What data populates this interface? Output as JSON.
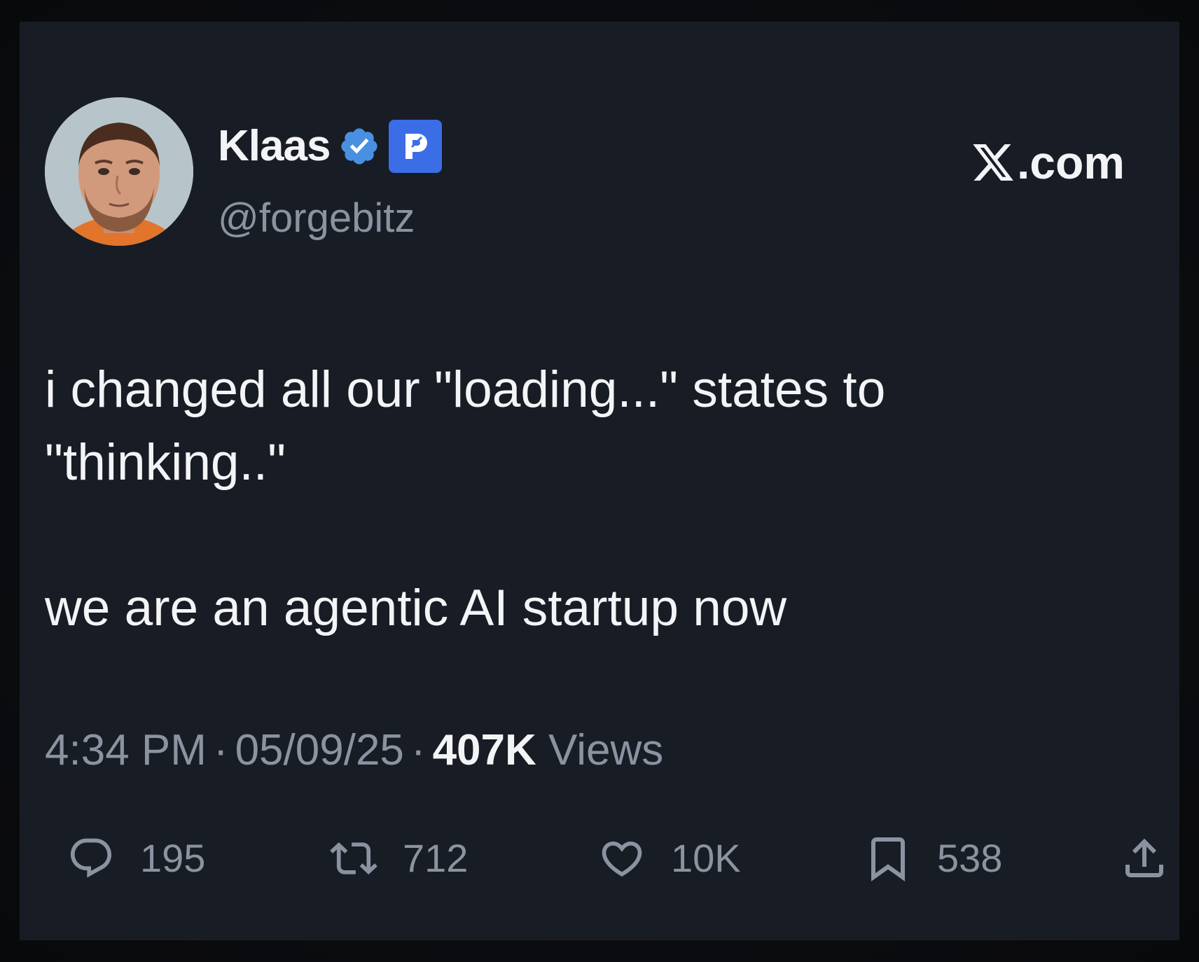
{
  "author": {
    "name": "Klaas",
    "handle": "@forgebitz",
    "verified_icon": "verified-badge-icon",
    "affiliate_icon": "brand-badge-icon"
  },
  "site": {
    "logo_icon": "x-logo-icon",
    "label": ".com"
  },
  "tweet": {
    "lines": [
      "i changed all our \"loading...\" states to",
      "\"thinking..\"",
      "",
      "we are an agentic AI startup now"
    ]
  },
  "meta": {
    "time": "4:34 PM",
    "separator": "·",
    "date": "05/09/25",
    "views_count": "407K",
    "views_label": "Views"
  },
  "actions": {
    "reply": {
      "icon": "reply-icon",
      "count": "195"
    },
    "retweet": {
      "icon": "retweet-icon",
      "count": "712"
    },
    "like": {
      "icon": "heart-icon",
      "count": "10K"
    },
    "bookmark": {
      "icon": "bookmark-icon",
      "count": "538"
    },
    "share": {
      "icon": "share-icon"
    }
  },
  "colors": {
    "background": "#181c24",
    "text_primary": "#f3f4f6",
    "text_secondary": "#8b93a1",
    "verified_blue": "#4a90e2",
    "brand_blue": "#3b6de6"
  }
}
